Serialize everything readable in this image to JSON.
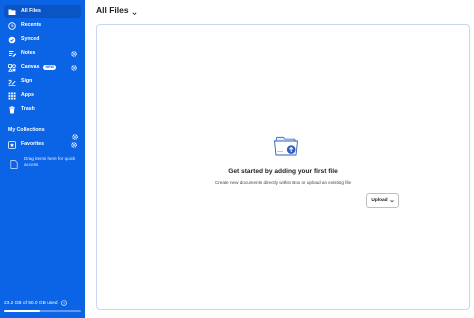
{
  "colors": {
    "sidebar": "#0b63e5",
    "sidebar_active": "#0a54c4",
    "border": "#c9d6f2"
  },
  "sidebar": {
    "items": [
      {
        "label": "All Files",
        "icon": "folder-icon",
        "active": true
      },
      {
        "label": "Recents",
        "icon": "clock-icon"
      },
      {
        "label": "Synced",
        "icon": "sync-icon"
      },
      {
        "label": "Notes",
        "icon": "notes-icon",
        "gear": true
      },
      {
        "label": "Canvas",
        "icon": "canvas-icon",
        "badge": "NEW",
        "gear": true
      },
      {
        "label": "Sign",
        "icon": "sign-icon"
      },
      {
        "label": "Apps",
        "icon": "apps-icon"
      },
      {
        "label": "Trash",
        "icon": "trash-icon"
      }
    ],
    "collections_title": "My Collections",
    "favorites": {
      "label": "Favorites",
      "icon": "favorites-icon"
    },
    "favorites_hint": "Drag items here for quick access",
    "storage": {
      "text": "23.2 GB of 50.0 GB used",
      "fraction": 0.464
    }
  },
  "main": {
    "title": "All Files",
    "empty_state": {
      "icon": "folder-upload-icon",
      "title": "Get started by adding your first file",
      "subtitle": "Create new documents directly within Box or upload an existing file"
    },
    "upload_label": "Upload"
  }
}
